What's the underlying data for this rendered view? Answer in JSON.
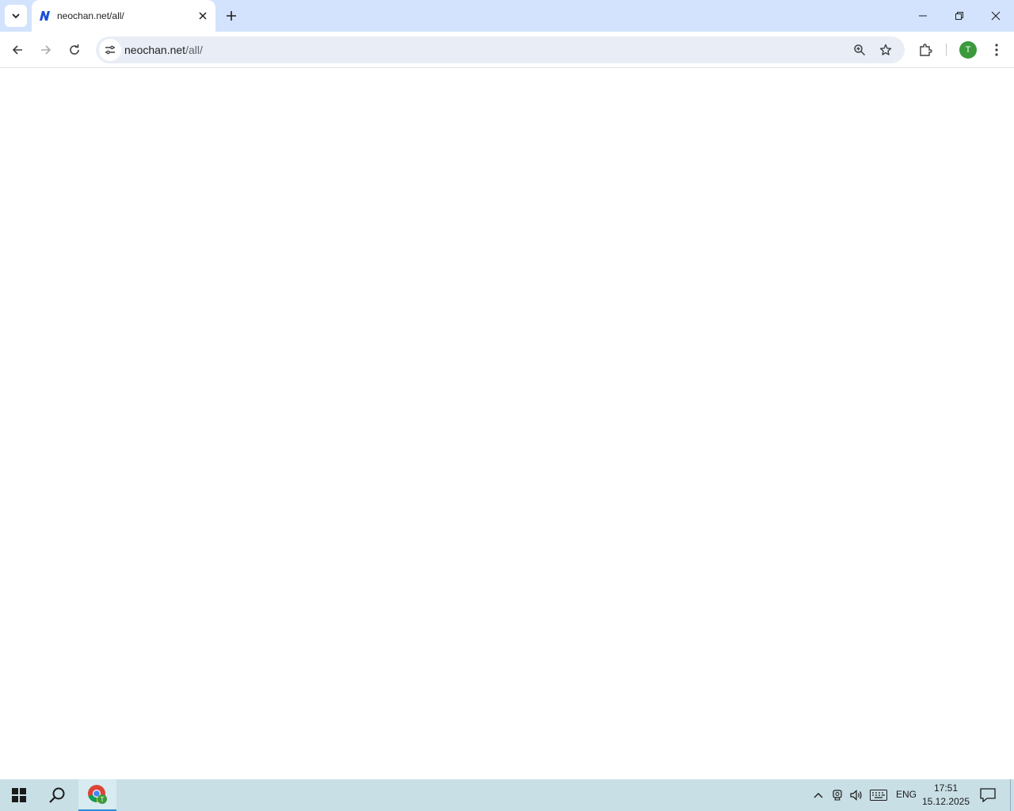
{
  "browser": {
    "tab": {
      "title": "neochan.net/all/",
      "favicon": "N"
    },
    "address": {
      "host": "neochan.net",
      "path": "/all/"
    },
    "profile_initial": "T"
  },
  "taskbar": {
    "language": "ENG",
    "time": "17:51",
    "date": "15.12.2025"
  },
  "colors": {
    "tab_strip": "#d3e3fd",
    "omnibox": "#e9eef6",
    "taskbar": "#c9dfe6",
    "avatar": "#3c9a3c"
  }
}
